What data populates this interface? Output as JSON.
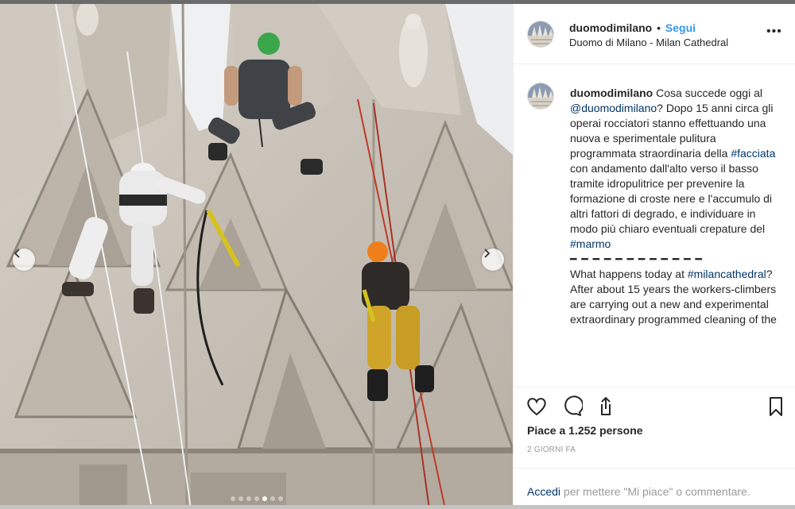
{
  "post": {
    "username": "duomodimilano",
    "follow_label": "Segui",
    "separator": "•",
    "location": "Duomo di Milano - Milan Cathedral",
    "more_label": "•••",
    "caption": {
      "username": "duomodimilano",
      "part1": " Cosa succede oggi al ",
      "mention": "@duomodimilano",
      "part2": "? Dopo 15 anni circa gli operai rocciatori stanno effettuando una nuova e sperimentale pulitura programmata straordinaria della ",
      "hashtag1": "#facciata",
      "part3": " con andamento dall'alto verso il basso tramite idropulitrice per prevenire la formazione di croste nere e l'accumulo di altri fattori di degrado, e individuare in modo più chiaro eventuali crepature del ",
      "hashtag2": "#marmo",
      "dashes": "━ ━ ━ ━ ━ ━ ━ ━ ━ ━ ━ ━",
      "part4": "What happens today at ",
      "hashtag3": "#milancathedral",
      "part5": "? After about 15 years the workers-climbers are carrying out a new and experimental extraordinary programmed cleaning of the"
    },
    "likes": "Piace a 1.252 persone",
    "time": "2 GIORNI FA",
    "login": {
      "link": "Accedi",
      "text": " per mettere \"Mi piace\" o commentare."
    }
  },
  "carousel": {
    "prev_icon": "chevron-left-icon",
    "next_icon": "chevron-right-icon",
    "dot_count": 7,
    "active_dot": 4
  },
  "icons": {
    "like": "heart-icon",
    "comment": "comment-icon",
    "share": "share-icon",
    "save": "bookmark-icon"
  },
  "colors": {
    "follow": "#3897f0",
    "link": "#003569",
    "secondary": "#999999",
    "stone": "#c9c3ba"
  }
}
